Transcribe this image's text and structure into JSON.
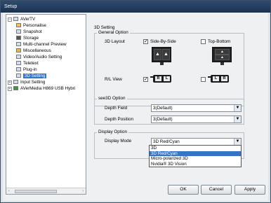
{
  "window": {
    "title": "Setup"
  },
  "tree": {
    "root": "AVerTV",
    "items": [
      "Personalise",
      "Snapshot",
      "Storage",
      "Multi-channel Preview",
      "Miscellaneous",
      "Video/Audio Setting",
      "Teletext",
      "Plug-in",
      "3D Setting"
    ],
    "input_setting": "Input Setting",
    "device": "AVerMedia H869 USB Hybri",
    "scroll_left": "‹",
    "scroll_right": "›"
  },
  "section_title": "3D Setting",
  "general": {
    "title": "General Option",
    "layout_label": "3D Layout",
    "side_by_side": "Side-By-Side",
    "top_bottom": "Top-Bottom",
    "rl_view": "R/L View",
    "lens_r": "R",
    "lens_l": "L",
    "check": "✓"
  },
  "see3d": {
    "title": "see3D Option",
    "depth_field_label": "Depth Field",
    "depth_field_value": "3(Default)",
    "depth_position_label": "Depth Position",
    "depth_position_value": "3(Default)"
  },
  "display": {
    "title": "Display Option",
    "mode_label": "Display Mode",
    "mode_value": "3D Red/Cyan",
    "options": [
      "3D",
      "3D Red/Cyan",
      "Micro-polarized 3D",
      "Nvidia® 3D Vision"
    ]
  },
  "buttons": {
    "ok": "OK",
    "cancel": "Cancel",
    "apply": "Apply"
  },
  "colors": {
    "selection": "#3574c8",
    "titlebar": "#1b3150"
  }
}
